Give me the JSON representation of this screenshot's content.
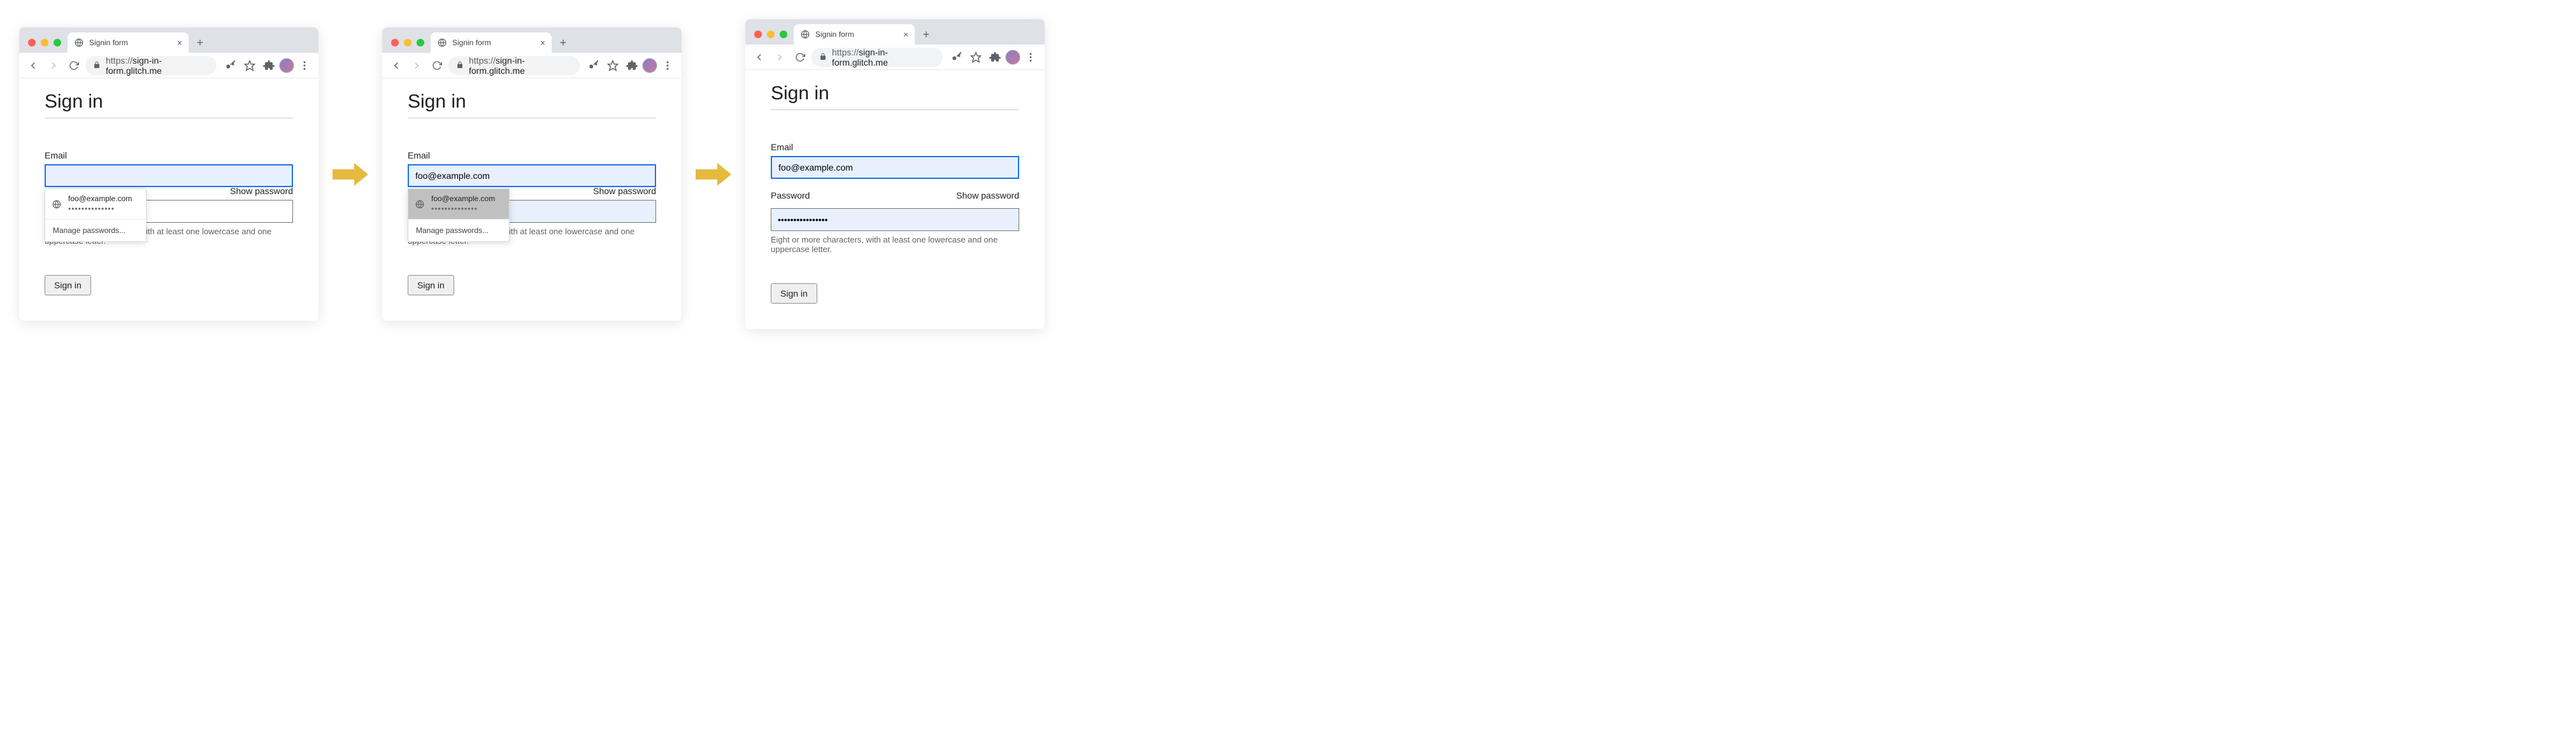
{
  "browser": {
    "tab_title": "Signin form",
    "url_scheme": "https://",
    "url_host": "sign-in-form.glitch.me",
    "new_tab": "+",
    "close_tab": "×"
  },
  "page": {
    "heading": "Sign in",
    "email_label": "Email",
    "password_label": "Password",
    "show_password": "Show password",
    "hint": "Eight or more characters, with at least one lowercase and one uppercase letter.",
    "submit": "Sign in"
  },
  "autocomplete": {
    "email": "foo@example.com",
    "dots": "••••••••••••••",
    "manage": "Manage passwords..."
  },
  "states": {
    "s1": {
      "email_value": "",
      "password_value": ""
    },
    "s2": {
      "email_value": "foo@example.com",
      "password_value": ""
    },
    "s3": {
      "email_value": "foo@example.com",
      "password_value": "••••••••••••••••"
    }
  }
}
